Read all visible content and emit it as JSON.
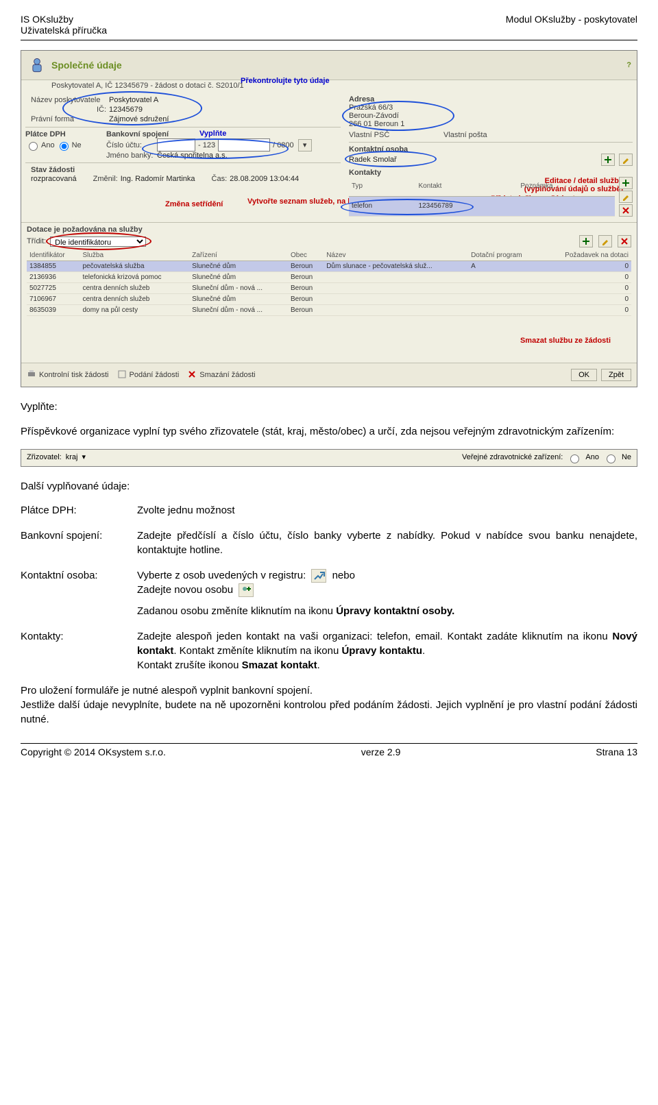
{
  "header": {
    "left": "IS OKslužby",
    "right": "Modul OKslužby - poskytovatel",
    "sub": "Uživatelská příručka"
  },
  "app": {
    "title_main": "Společné údaje",
    "subtitle": "Poskytovatel A, IČ 12345679 - žádost o dotaci č. S2010/1",
    "annotations": {
      "overkontrol": "Překontrolujte tyto údaje",
      "vyplnte": "Vyplňte",
      "zmena_setrideni": "Změna setřídění",
      "vytvorte": "Vytvořte seznam služeb, na které žádáte o dotaci",
      "editace1": "Editace / detail služby",
      "editace2": "(vyplňování údajů o službě)",
      "pridat1": "Přidat službu na žádost",
      "pridat2": "(nabídka z registru)",
      "smazat": "Smazat službu ze žádosti"
    },
    "left_fields": {
      "nazev_label": "Název poskytovatele",
      "nazev_val": "Poskytovatel A",
      "ic_label": "IČ:",
      "ic_val": "12345679",
      "forma_label": "Právní forma",
      "forma_val": "Zájmové sdružení"
    },
    "adresa": {
      "heading": "Adresa",
      "line1": "Pražská 66/3",
      "line2": "Beroun-Závodí",
      "line3": "266 01 Beroun 1",
      "psc_label": "Vlastní PSČ",
      "posta_label": "Vlastní pošta"
    },
    "dph": {
      "group_label": "Plátce DPH",
      "ano": "Ano",
      "ne": "Ne"
    },
    "bank": {
      "group_label": "Bankovní spojení",
      "cislo_label": "Číslo účtu:",
      "pre": "",
      "sep": "- 123",
      "suf": "/ 0800",
      "jmeno_label": "Jméno banky:",
      "jmeno_val": "Česká spořitelna a.s."
    },
    "kontakt_osoba": {
      "group_label": "Kontaktní osoba",
      "val": "Radek Smolař"
    },
    "kontakty": {
      "group_label": "Kontakty",
      "typ_h": "Typ",
      "kontakt_h": "Kontakt",
      "pozn_h": "Poznámka",
      "row_typ": "telefon",
      "row_kontakt": "123456789"
    },
    "stav": {
      "label": "Stav žádosti",
      "val": "rozpracovaná",
      "zmenil_label": "Změnil:",
      "zmenil_val": "Ing. Radomír Martinka",
      "cas_label": "Čas:",
      "cas_val": "28.08.2009 13:04:44"
    },
    "sluzby": {
      "section_label": "Dotace je požadována na služby",
      "tridit_label": "Třídit:",
      "tridit_val": "Dle identifikátoru",
      "th_id": "Identifikátor",
      "th_sluzba": "Služba",
      "th_zarizeni": "Zařízení",
      "th_obec": "Obec",
      "th_nazev": "Název",
      "th_dp": "Dotační program",
      "th_pd": "Požadavek na dotaci",
      "rows": [
        {
          "id": "1384855",
          "sluzba": "pečovatelská služba",
          "zar": "Slunečné dům",
          "obec": "Beroun",
          "nazev": "Dům slunace - pečovatelská služ...",
          "dp": "A",
          "pd": "0"
        },
        {
          "id": "2136936",
          "sluzba": "telefonická krizová pomoc",
          "zar": "Slunečné dům",
          "obec": "Beroun",
          "nazev": "",
          "dp": "",
          "pd": "0"
        },
        {
          "id": "5027725",
          "sluzba": "centra denních služeb",
          "zar": "Sluneční dům - nová ...",
          "obec": "Beroun",
          "nazev": "",
          "dp": "",
          "pd": "0"
        },
        {
          "id": "7106967",
          "sluzba": "centra denních služeb",
          "zar": "Slunečné dům",
          "obec": "Beroun",
          "nazev": "",
          "dp": "",
          "pd": "0"
        },
        {
          "id": "8635039",
          "sluzba": "domy na půl cesty",
          "zar": "Sluneční dům - nová ...",
          "obec": "Beroun",
          "nazev": "",
          "dp": "",
          "pd": "0"
        }
      ]
    },
    "footer": {
      "kontrolni": "Kontrolní tisk žádosti",
      "podani": "Podání žádosti",
      "smazani": "Smazání žádosti",
      "ok": "OK",
      "zpet": "Zpět"
    },
    "help_tip": "?"
  },
  "body": {
    "vyplnte_h": "Vyplňte:",
    "vyplnte_p": "Příspěvkové organizace vyplní typ svého zřizovatele (stát, kraj, město/obec) a určí, zda nejsou veřejným zdravotnickým zařízením:",
    "form2": {
      "zr_label": "Zřizovatel:",
      "zr_val": "kraj",
      "vz_label": "Veřejné zdravotnické zařízení:",
      "ano": "Ano",
      "ne": "Ne"
    },
    "dalsi_h": "Další vyplňované údaje:",
    "rows": {
      "dph_l": "Plátce DPH:",
      "dph_v": "Zvolte jednu možnost",
      "bank_l": "Bankovní spojení:",
      "bank_v": "Zadejte předčíslí a číslo účtu, číslo banky vyberte z nabídky. Pokud v nabídce svou banku nenajdete, kontaktujte hotline.",
      "ko_l": "Kontaktní osoba:",
      "ko_v_pre": "Vyberte z osob uvedených v registru:",
      "ko_v_suf": "nebo",
      "ko_v2": "Zadejte novou osobu",
      "ko_v3": "Zadanou osobu změníte kliknutím na ikonu",
      "ko_v3_b": "Úpravy kontaktní osoby.",
      "kt_l": "Kontakty:",
      "kt_p1": "Zadejte alespoň jeden kontakt na vaši organizaci: telefon, email. Kontakt zadáte kliknutím na ikonu",
      "kt_p1_b": "Nový kontakt",
      "kt_p1_c": ". Kontakt změníte kliknutím na ikonu",
      "kt_p1_d": "Úpravy kontaktu",
      "kt_p1_e": ".",
      "kt_p2": "Kontakt zrušíte ikonou",
      "kt_p2_b": "Smazat kontakt",
      "kt_p2_c": "."
    },
    "tail": "Pro uložení formuláře je nutné alespoň vyplnit bankovní spojení.\nJestliže další údaje nevyplníte, budete na ně upozorněni kontrolou před podáním žádosti. Jejich vyplnění je pro vlastní podání žádosti nutné."
  },
  "footer": {
    "left": "Copyright © 2014 OKsystem s.r.o.",
    "mid": "verze 2.9",
    "right": "Strana 13"
  }
}
